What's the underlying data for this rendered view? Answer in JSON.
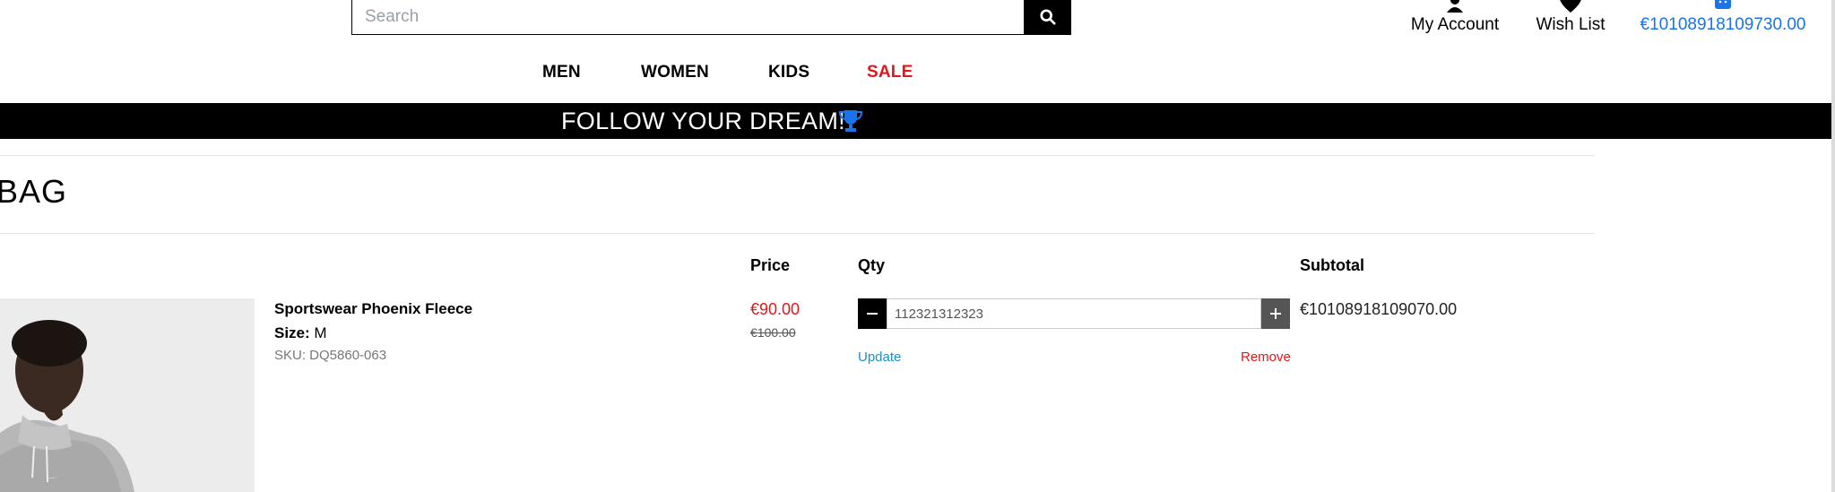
{
  "header": {
    "search": {
      "placeholder": "Search",
      "value": ""
    },
    "account_label": "My Account",
    "wishlist_label": "Wish List",
    "cart_total": "€10108918109730.00"
  },
  "nav": {
    "items": [
      "MEN",
      "WOMEN",
      "KIDS",
      "SALE"
    ]
  },
  "banner": {
    "text": "FOLLOW YOUR DREAM!",
    "icon": "trophy-icon"
  },
  "page": {
    "title": "BAG"
  },
  "cart_table": {
    "headers": {
      "price": "Price",
      "qty": "Qty",
      "subtotal": "Subtotal"
    },
    "items": [
      {
        "name": "Sportswear Phoenix Fleece",
        "size_label": "Size:",
        "size_value": "M",
        "sku": "SKU: DQ5860-063",
        "price": "€90.00",
        "original_price": "€100.00",
        "qty": "112321312323",
        "update_label": "Update",
        "remove_label": "Remove",
        "subtotal": "€10108918109070.00"
      }
    ]
  },
  "colors": {
    "sale_red": "#e1171e",
    "link_blue": "#1a8fc9",
    "cart_blue": "#1a73e8",
    "banner_bg": "#000000"
  }
}
